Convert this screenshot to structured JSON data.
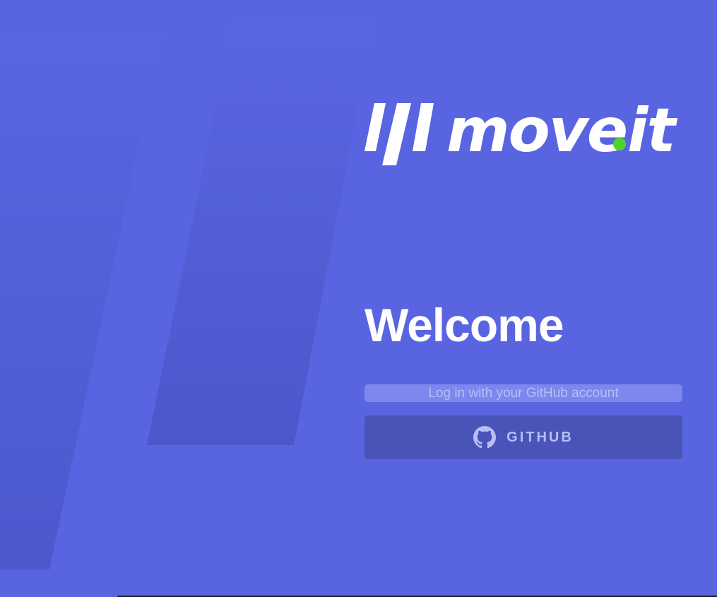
{
  "brand": {
    "name": "move.it",
    "accent_dot_color": "#4cd62b",
    "logo_text_color": "#ffffff"
  },
  "welcome": {
    "title": "Welcome"
  },
  "login": {
    "subtitle": "Log in with your GitHub account",
    "button_label": "GITHUB",
    "button_icon": "github-icon"
  },
  "colors": {
    "background": "#5965e0",
    "button_bg": "#4953b8",
    "subtitle_bar": "#7d87ee",
    "muted_text": "#b8bef6"
  }
}
